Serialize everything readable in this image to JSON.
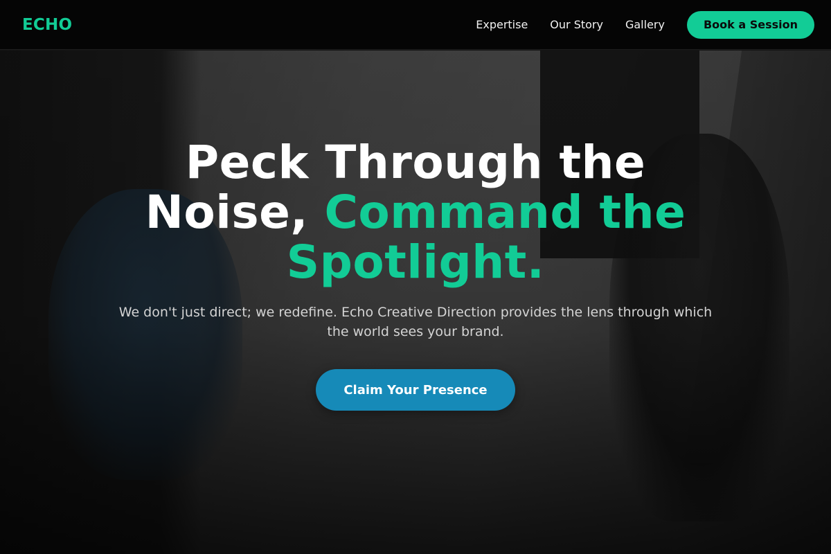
{
  "brand": {
    "logo_text": "ECHO",
    "accent_color": "#12cc96",
    "cta_color": "#168ab8"
  },
  "nav": {
    "links": [
      {
        "label": "Expertise"
      },
      {
        "label": "Our Story"
      },
      {
        "label": "Gallery"
      }
    ],
    "book_button": "Book a Session"
  },
  "hero": {
    "background_image": "photographer kneeling with camera photographing a seated woman in a leather jacket",
    "headline_part1": "Peck Through the Noise, ",
    "headline_part2": "Command the Spotlight.",
    "subtitle": "We don't just direct; we redefine. Echo Creative Direction provides the lens through which the world sees your brand.",
    "cta_button": "Claim Your Presence"
  }
}
